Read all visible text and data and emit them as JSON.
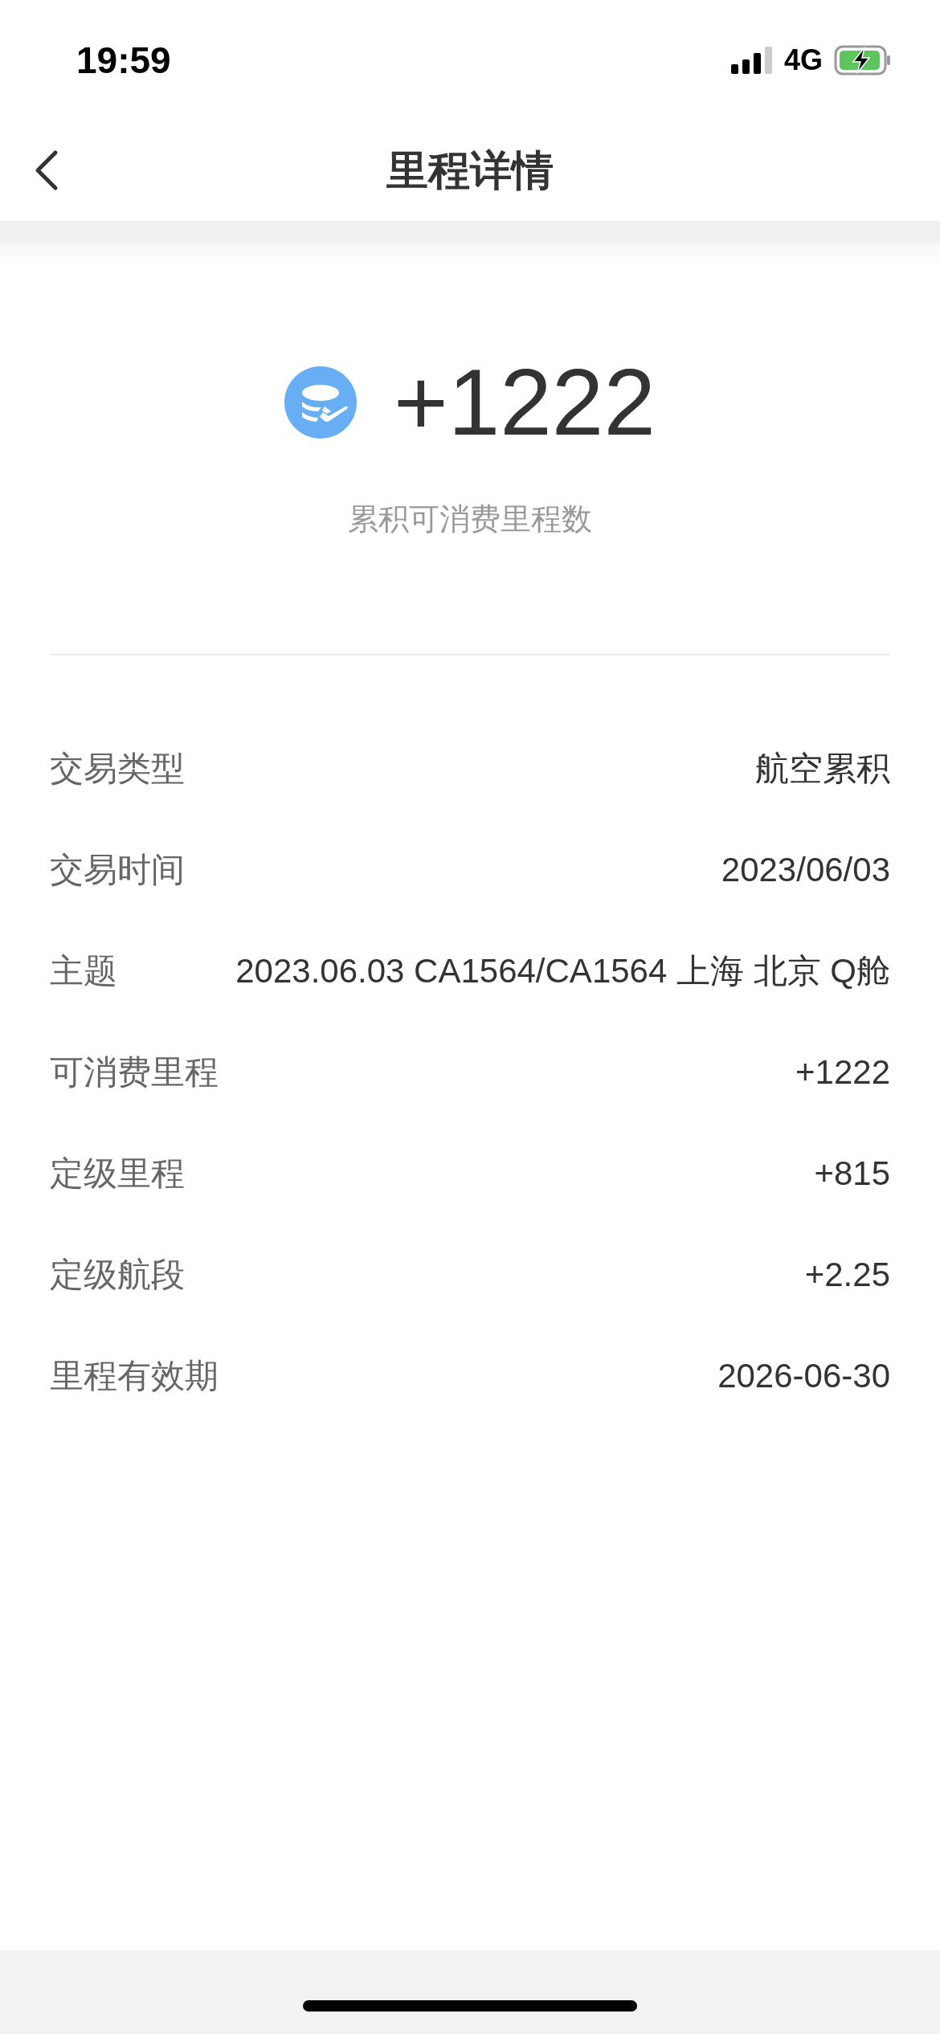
{
  "status_bar": {
    "time": "19:59",
    "network": "4G"
  },
  "nav": {
    "title": "里程详情"
  },
  "summary": {
    "amount": "+1222",
    "caption": "累积可消费里程数"
  },
  "details": [
    {
      "label": "交易类型",
      "value": "航空累积"
    },
    {
      "label": "交易时间",
      "value": "2023/06/03"
    },
    {
      "label": "主题",
      "value": "2023.06.03 CA1564/CA1564 上海 北京 Q舱"
    },
    {
      "label": "可消费里程",
      "value": "+1222"
    },
    {
      "label": "定级里程",
      "value": "+815"
    },
    {
      "label": "定级航段",
      "value": "+2.25"
    },
    {
      "label": "里程有效期",
      "value": "2026-06-30"
    }
  ]
}
